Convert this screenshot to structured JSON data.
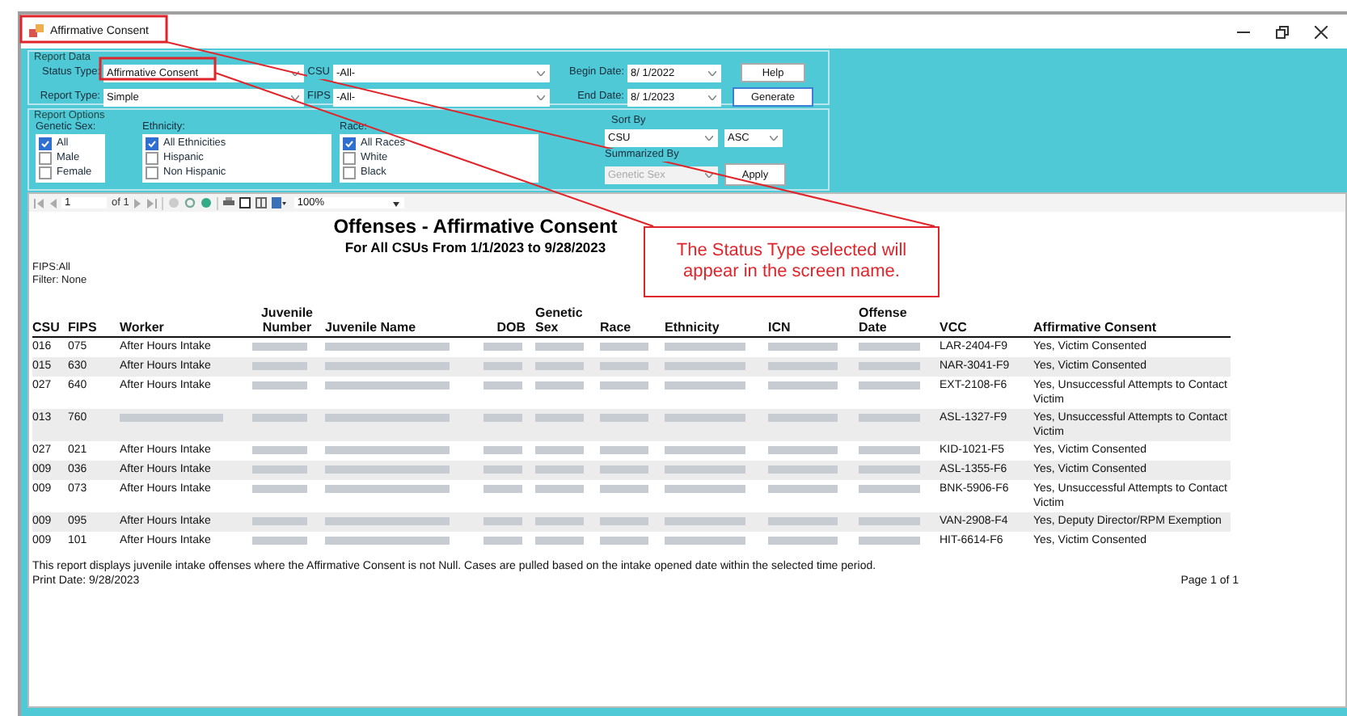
{
  "window": {
    "title": "Affirmative Consent"
  },
  "report_data": {
    "group_label": "Report Data",
    "status_type": {
      "label": "Status Type:",
      "value": "Affirmative Consent"
    },
    "report_type": {
      "label": "Report Type:",
      "value": "Simple"
    },
    "csu": {
      "label": "CSU",
      "value": "-All-"
    },
    "fips": {
      "label": "FIPS",
      "value": "-All-"
    },
    "begin_date": {
      "label": "Begin Date:",
      "value": "8/ 1/2022"
    },
    "end_date": {
      "label": "End Date:",
      "value": "8/ 1/2023"
    },
    "help_button": "Help",
    "generate_button": "Generate"
  },
  "report_options": {
    "group_label": "Report Options",
    "lists": [
      {
        "label": "Genetic Sex:",
        "items": [
          {
            "label": "All",
            "checked": true
          },
          {
            "label": "Male",
            "checked": false
          },
          {
            "label": "Female",
            "checked": false
          }
        ]
      },
      {
        "label": "Ethnicity:",
        "items": [
          {
            "label": "All Ethnicities",
            "checked": true
          },
          {
            "label": "Hispanic",
            "checked": false
          },
          {
            "label": "Non Hispanic",
            "checked": false
          }
        ]
      },
      {
        "label": "Race:",
        "items": [
          {
            "label": "All Races",
            "checked": true
          },
          {
            "label": "White",
            "checked": false
          },
          {
            "label": "Black",
            "checked": false
          }
        ]
      }
    ],
    "sort_by": {
      "label": "Sort By",
      "value": "CSU",
      "order": "ASC"
    },
    "summarized_by": {
      "label": "Summarized By",
      "value": "Genetic Sex",
      "disabled": true
    },
    "apply_button": "Apply"
  },
  "viewer_toolbar": {
    "page": "1",
    "page_count": "of 1",
    "zoom": "100%"
  },
  "report": {
    "title": "Offenses - Affirmative Consent",
    "subtitle": "For All CSUs From 1/1/2023 to 9/28/2023",
    "fips": "FIPS:All",
    "filter": "Filter: None",
    "columns": [
      "CSU",
      "FIPS",
      "Worker",
      "Juvenile Number",
      "Juvenile Name",
      "DOB",
      "Genetic Sex",
      "Race",
      "Ethnicity",
      "ICN",
      "Offense Date",
      "VCC",
      "Affirmative Consent"
    ],
    "rows": [
      [
        "016",
        "075",
        "After Hours Intake",
        null,
        null,
        null,
        null,
        null,
        null,
        null,
        null,
        "LAR-2404-F9",
        "Yes, Victim Consented"
      ],
      [
        "015",
        "630",
        "After Hours Intake",
        null,
        null,
        null,
        null,
        null,
        null,
        null,
        null,
        "NAR-3041-F9",
        "Yes, Victim Consented"
      ],
      [
        "027",
        "640",
        "After Hours Intake",
        null,
        null,
        null,
        null,
        null,
        null,
        null,
        null,
        "EXT-2108-F6",
        "Yes, Unsuccessful Attempts to Contact Victim"
      ],
      [
        "013",
        "760",
        null,
        null,
        null,
        null,
        null,
        null,
        null,
        null,
        null,
        "ASL-1327-F9",
        "Yes, Unsuccessful Attempts to Contact Victim"
      ],
      [
        "027",
        "021",
        "After Hours Intake",
        null,
        null,
        null,
        null,
        null,
        null,
        null,
        null,
        "KID-1021-F5",
        "Yes, Victim Consented"
      ],
      [
        "009",
        "036",
        "After Hours Intake",
        null,
        null,
        null,
        null,
        null,
        null,
        null,
        null,
        "ASL-1355-F6",
        "Yes, Victim Consented"
      ],
      [
        "009",
        "073",
        "After Hours Intake",
        null,
        null,
        null,
        null,
        null,
        null,
        null,
        null,
        "BNK-5906-F6",
        "Yes, Unsuccessful Attempts to Contact Victim"
      ],
      [
        "009",
        "095",
        "After Hours Intake",
        null,
        null,
        null,
        null,
        null,
        null,
        null,
        null,
        "VAN-2908-F4",
        "Yes, Deputy Director/RPM Exemption"
      ],
      [
        "009",
        "101",
        "After Hours Intake",
        null,
        null,
        null,
        null,
        null,
        null,
        null,
        null,
        "HIT-6614-F6",
        "Yes, Victim Consented"
      ]
    ],
    "footnote": "This report displays juvenile intake offenses where the Affirmative Consent is not Null. Cases are pulled based on the intake opened date within the selected time period.",
    "print_date": "Print Date: 9/28/2023",
    "page_label": "Page 1 of 1"
  },
  "callout": {
    "text": "The Status Type selected will appear in the screen name."
  }
}
